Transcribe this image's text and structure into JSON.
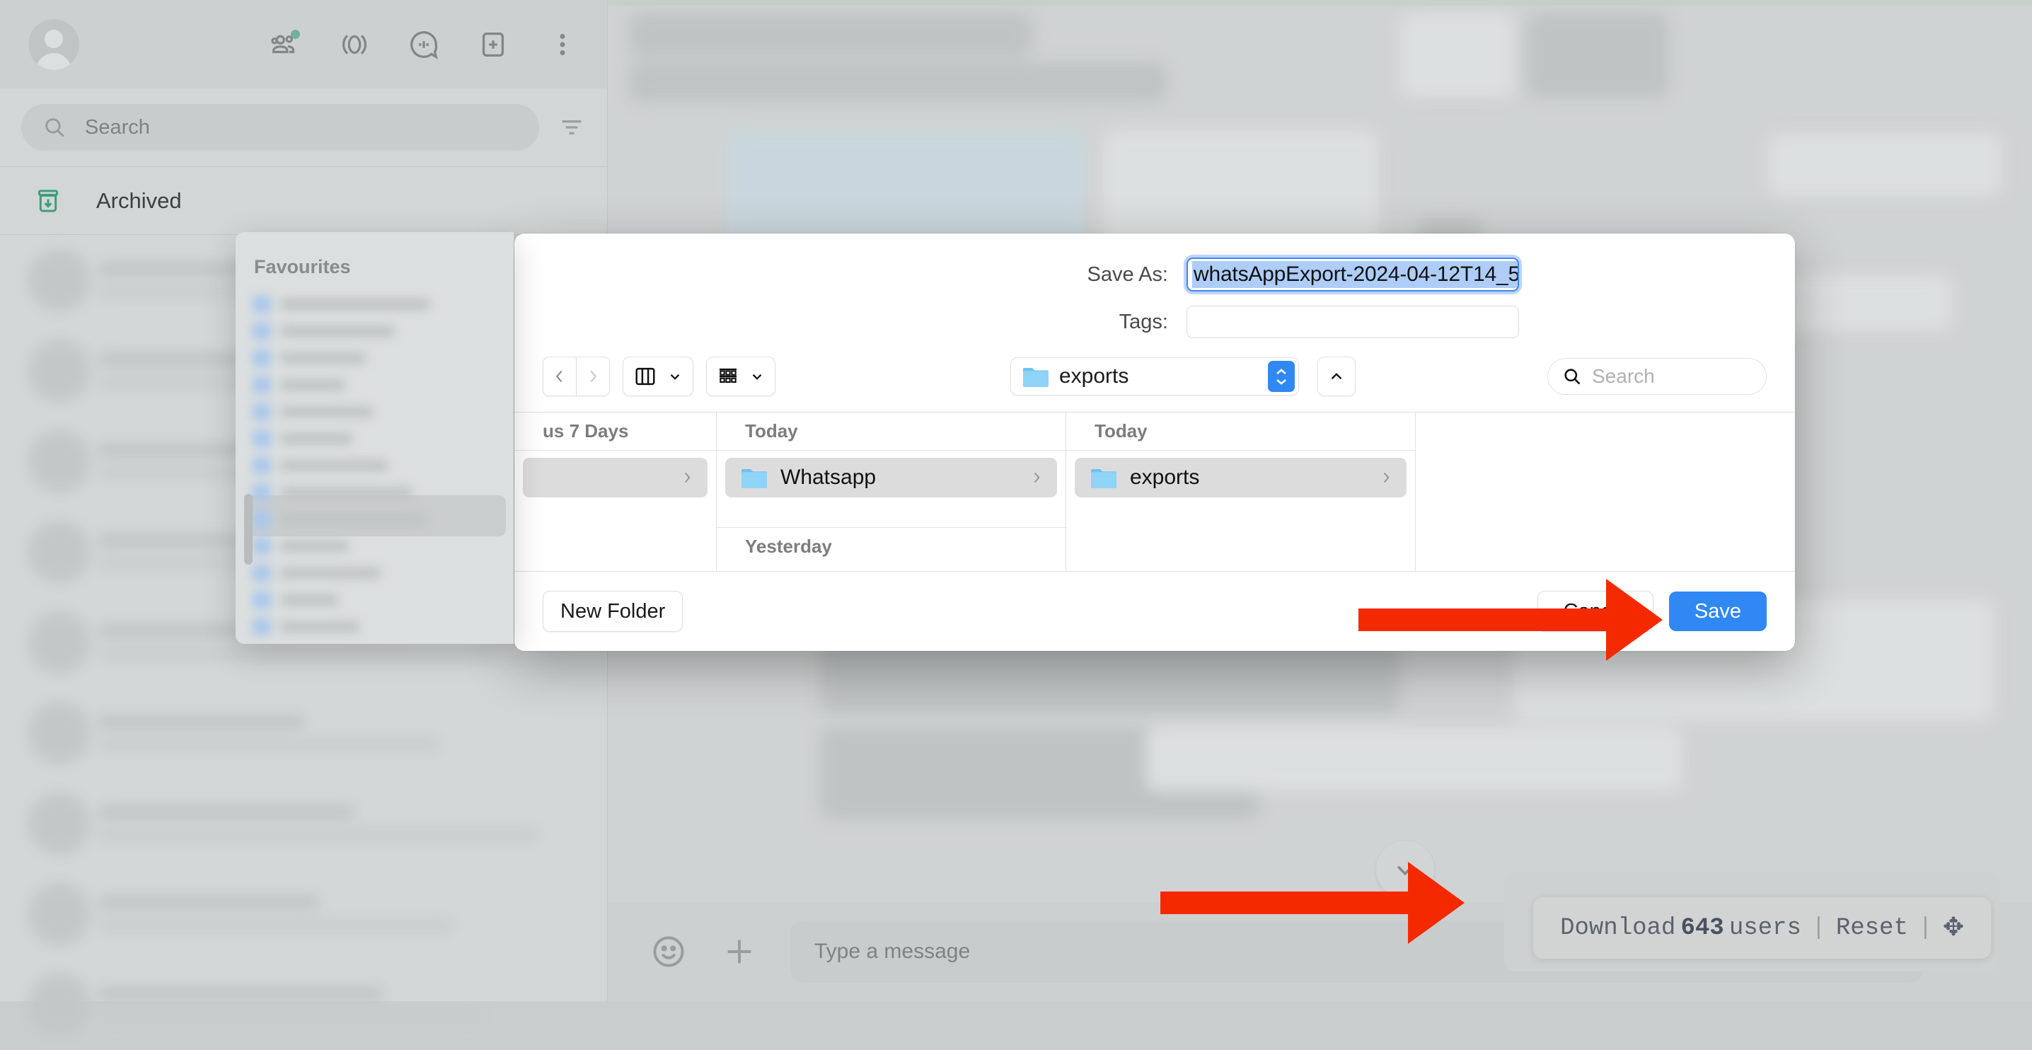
{
  "app": {
    "sidebar": {
      "search_placeholder": "Search",
      "archived_label": "Archived",
      "icons": [
        {
          "name": "communities-icon",
          "has_badge": true
        },
        {
          "name": "status-icon",
          "has_badge": false
        },
        {
          "name": "channels-icon",
          "has_badge": false
        },
        {
          "name": "new-chat-icon",
          "has_badge": false
        },
        {
          "name": "menu-dots-icon",
          "has_badge": false
        }
      ],
      "avatar_name": "user-avatar",
      "filter_icon": "filter-icon"
    },
    "chat": {
      "message_placeholder": "Type a message",
      "emoji_icon": "emoji-icon",
      "attach_icon": "plus-attach-icon",
      "mic_icon": "microphone-icon",
      "scroll_down_icon": "chevron-down-icon"
    },
    "download_widget": {
      "download_label": "Download",
      "count": "643",
      "users_label": "users",
      "separator": "|",
      "reset_label": "Reset",
      "move_icon": "move-handle-icon"
    }
  },
  "favourites_popover": {
    "title": "Favourites"
  },
  "save_dialog": {
    "save_as_label": "Save As:",
    "filename_value": "whatsAppExport-2024-04-12T14_5",
    "tags_label": "Tags:",
    "tags_value": "",
    "toolbar": {
      "back_icon": "chevron-left-icon",
      "forward_icon": "chevron-right-icon",
      "view_mode_icon": "column-view-icon",
      "view_mode_chevron": "chevron-down-icon",
      "group_by_icon": "group-by-icon",
      "group_by_chevron": "chevron-down-icon",
      "path_folder_icon": "folder-icon",
      "path_label": "exports",
      "stepper_icon": "up-down-stepper-icon",
      "up_icon": "chevron-up-icon",
      "search_icon": "search-icon",
      "search_placeholder": "Search"
    },
    "columns": [
      {
        "name": "column-1",
        "header": "us 7 Days",
        "items": [
          {
            "label": "",
            "selected": true,
            "has_chevron": true
          }
        ],
        "sub_headers": []
      },
      {
        "name": "column-2",
        "header": "Today",
        "items": [
          {
            "label": "Whatsapp",
            "selected": true,
            "has_chevron": true
          }
        ],
        "sub_headers": [
          "Yesterday"
        ]
      },
      {
        "name": "column-3",
        "header": "Today",
        "items": [
          {
            "label": "exports",
            "selected": true,
            "has_chevron": true
          }
        ],
        "sub_headers": []
      },
      {
        "name": "column-4",
        "header": "",
        "items": [],
        "sub_headers": []
      }
    ],
    "footer": {
      "new_folder_label": "New Folder",
      "cancel_label": "Cancel",
      "save_label": "Save"
    }
  },
  "annotations": {
    "arrow_color": "#f52900",
    "arrows": [
      {
        "name": "arrow-to-save-button"
      },
      {
        "name": "arrow-to-download-widget"
      }
    ]
  }
}
